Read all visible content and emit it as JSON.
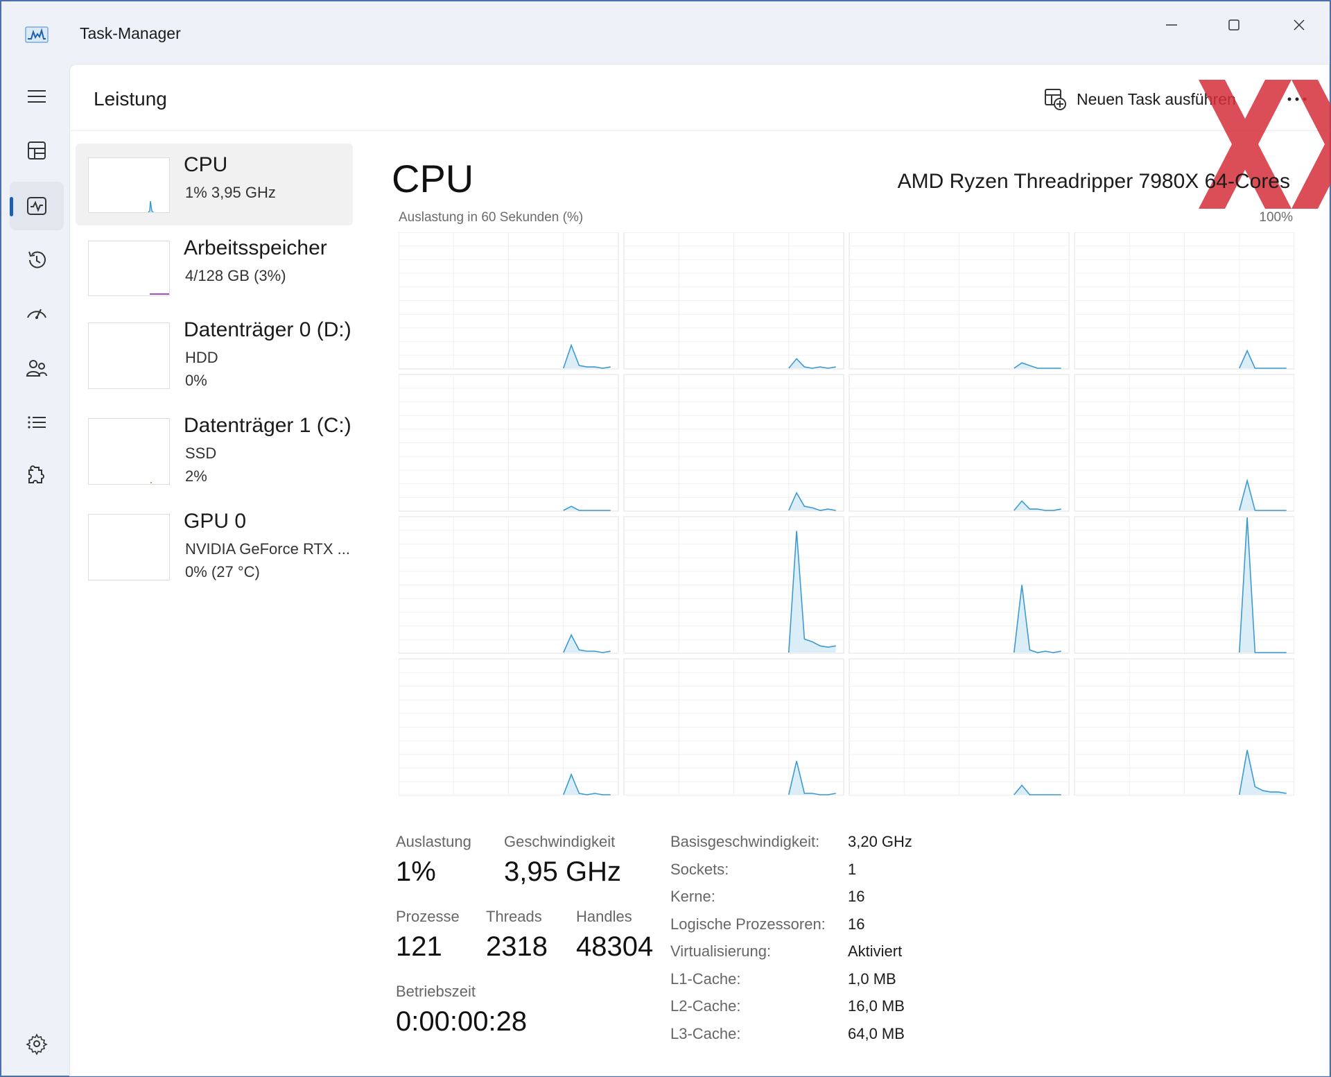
{
  "window": {
    "title": "Task-Manager",
    "accent": "#1b5fb4",
    "graph_color": "#3c9ad1"
  },
  "nav": {
    "items": [
      {
        "name": "menu",
        "icon": "hamburger-icon"
      },
      {
        "name": "processes",
        "icon": "processes-icon"
      },
      {
        "name": "performance",
        "icon": "performance-icon",
        "active": true
      },
      {
        "name": "app-history",
        "icon": "history-icon"
      },
      {
        "name": "startup-apps",
        "icon": "startup-icon"
      },
      {
        "name": "users",
        "icon": "users-icon"
      },
      {
        "name": "details",
        "icon": "details-list-icon"
      },
      {
        "name": "services",
        "icon": "services-icon"
      },
      {
        "name": "settings",
        "icon": "gear-icon"
      }
    ]
  },
  "header": {
    "title": "Leistung",
    "run_task_label": "Neuen Task ausführen",
    "more_label": "•••"
  },
  "devices": [
    {
      "name": "CPU",
      "line1": "1%  3,95 GHz",
      "line2": "",
      "selected": true
    },
    {
      "name": "Arbeitsspeicher",
      "line1": "4/128 GB (3%)",
      "line2": ""
    },
    {
      "name": "Datenträger 0 (D:)",
      "line1": "HDD",
      "line2": "0%"
    },
    {
      "name": "Datenträger 1 (C:)",
      "line1": "SSD",
      "line2": "2%"
    },
    {
      "name": "GPU 0",
      "line1": "NVIDIA GeForce RTX ...",
      "line2": "0%  (27 °C)"
    }
  ],
  "cpu": {
    "heading": "CPU",
    "model": "AMD Ryzen Threadripper 7980X 64-Cores",
    "graph_caption": "Auslastung in 60 Sekunden (%)",
    "graph_max": "100%",
    "core_spikes": [
      {
        "peak": 0.17,
        "after": [
          0.02,
          0.01,
          0.01,
          0.0,
          0.01
        ]
      },
      {
        "peak": 0.07,
        "after": [
          0.01,
          0.0,
          0.01,
          0.0,
          0.01
        ]
      },
      {
        "peak": 0.04,
        "after": [
          0.02,
          0.0,
          0.0,
          0.0,
          0.0
        ]
      },
      {
        "peak": 0.13,
        "after": [
          0.0,
          0.0,
          0.0,
          0.0,
          0.0
        ]
      },
      {
        "peak": 0.03,
        "after": [
          0.0,
          0.0,
          0.0,
          0.0,
          0.0
        ]
      },
      {
        "peak": 0.13,
        "after": [
          0.03,
          0.02,
          0.0,
          0.01,
          0.0
        ]
      },
      {
        "peak": 0.07,
        "after": [
          0.01,
          0.01,
          0.0,
          0.0,
          0.01
        ]
      },
      {
        "peak": 0.22,
        "after": [
          0.0,
          0.0,
          0.0,
          0.0,
          0.0
        ]
      },
      {
        "peak": 0.13,
        "after": [
          0.02,
          0.01,
          0.01,
          0.0,
          0.01
        ]
      },
      {
        "peak": 0.9,
        "after": [
          0.1,
          0.08,
          0.05,
          0.04,
          0.05
        ]
      },
      {
        "peak": 0.5,
        "after": [
          0.02,
          0.0,
          0.01,
          0.0,
          0.01
        ]
      },
      {
        "peak": 1.0,
        "after": [
          0.0,
          0.0,
          0.0,
          0.0,
          0.0
        ]
      },
      {
        "peak": 0.15,
        "after": [
          0.01,
          0.0,
          0.01,
          0.0,
          0.0
        ]
      },
      {
        "peak": 0.25,
        "after": [
          0.01,
          0.01,
          0.0,
          0.0,
          0.01
        ]
      },
      {
        "peak": 0.07,
        "after": [
          0.0,
          0.0,
          0.0,
          0.0,
          0.0
        ]
      },
      {
        "peak": 0.33,
        "after": [
          0.06,
          0.03,
          0.02,
          0.02,
          0.01
        ]
      }
    ]
  },
  "stats": {
    "auslastung_label": "Auslastung",
    "auslastung_value": "1%",
    "geschwindigkeit_label": "Geschwindigkeit",
    "geschwindigkeit_value": "3,95 GHz",
    "prozesse_label": "Prozesse",
    "prozesse_value": "121",
    "threads_label": "Threads",
    "threads_value": "2318",
    "handles_label": "Handles",
    "handles_value": "48304",
    "betriebszeit_label": "Betriebszeit",
    "betriebszeit_value": "0:00:00:28"
  },
  "specs": [
    {
      "label": "Basisgeschwindigkeit:",
      "value": "3,20 GHz"
    },
    {
      "label": "Sockets:",
      "value": "1"
    },
    {
      "label": "Kerne:",
      "value": "16"
    },
    {
      "label": "Logische Prozessoren:",
      "value": "16"
    },
    {
      "label": "Virtualisierung:",
      "value": "Aktiviert"
    },
    {
      "label": "L1-Cache:",
      "value": "1,0 MB"
    },
    {
      "label": "L2-Cache:",
      "value": "16,0 MB"
    },
    {
      "label": "L3-Cache:",
      "value": "64,0 MB"
    }
  ]
}
